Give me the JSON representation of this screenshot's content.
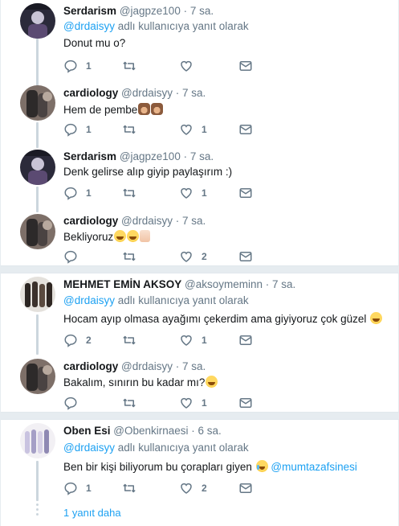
{
  "tweets": [
    {
      "name": "Serdarism",
      "handle": "@jagpze100",
      "time": "· 7 sa.",
      "replying_prefix": "",
      "replying_mention": "@drdaisyy",
      "replying_suffix": " adlı kullanıcıya yanıt olarak",
      "text": "Donut mu o?",
      "reply_count": "1",
      "retweet_count": "",
      "like_count": ""
    },
    {
      "name": "cardiology",
      "handle": "@drdaisyy",
      "time": "· 7 sa.",
      "text": "Hem de pembe",
      "reply_count": "1",
      "retweet_count": "",
      "like_count": "1"
    },
    {
      "name": "Serdarism",
      "handle": "@jagpze100",
      "time": "· 7 sa.",
      "text": "Denk gelirse alıp giyip paylaşırım :)",
      "reply_count": "1",
      "retweet_count": "",
      "like_count": "1"
    },
    {
      "name": "cardiology",
      "handle": "@drdaisyy",
      "time": "· 7 sa.",
      "text": "Bekliyoruz",
      "reply_count": "",
      "retweet_count": "",
      "like_count": "2"
    },
    {
      "name": "MEHMET EMİN AKSOY",
      "handle": "@aksoymeminn",
      "time": "· 7 sa.",
      "replying_mention": "@drdaisyy",
      "replying_suffix": " adlı kullanıcıya yanıt olarak",
      "text": "Hocam ayıp olmasa ayağımı çekerdim ama giyiyoruz çok güzel",
      "reply_count": "2",
      "retweet_count": "",
      "like_count": "1"
    },
    {
      "name": "cardiology",
      "handle": "@drdaisyy",
      "time": "· 7 sa.",
      "text": "Bakalım, sınırın bu kadar mı?",
      "reply_count": "",
      "retweet_count": "",
      "like_count": "1"
    },
    {
      "name": "Oben Esi",
      "handle": "@Obenkirnaesi",
      "time": "· 6 sa.",
      "replying_mention": "@drdaisyy",
      "replying_suffix": " adlı kullanıcıya yanıt olarak",
      "text": "Ben bir kişi biliyorum bu çorapları giyen",
      "text_mention": "@mumtazafsinesi",
      "reply_count": "1",
      "retweet_count": "",
      "like_count": "2"
    }
  ],
  "more_replies": "1 yanıt daha",
  "icons": {
    "reply": "reply-icon",
    "retweet": "retweet-icon",
    "like": "heart-icon",
    "dm": "envelope-icon"
  },
  "colors": {
    "accent": "#1da1f2",
    "muted": "#657786",
    "line": "#ccd6dd"
  }
}
